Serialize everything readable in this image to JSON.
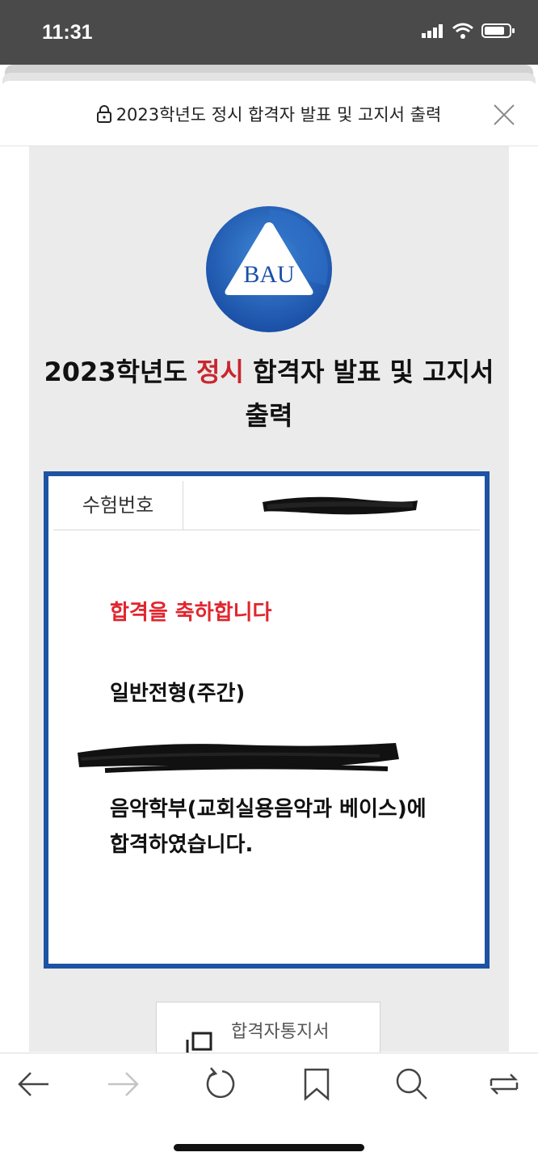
{
  "status_bar": {
    "time": "11:31"
  },
  "sheet": {
    "title": "2023학년도 정시 합격자 발표 및 고지서 출력"
  },
  "page": {
    "logo_text": "BAU",
    "title_prefix": "2023학년도 ",
    "title_accent": "정시",
    "title_suffix": " 합격자 발표 및 고지서 출력"
  },
  "result": {
    "exam_number_label": "수험번호",
    "congrats": "합격을 축하합니다",
    "track": "일반전형(주간)",
    "department": "음악학부(교회실용음악과 베이스)에",
    "passed": "합격하였습니다."
  },
  "cert_button": {
    "label": "합격자통지서"
  },
  "colors": {
    "accent_red": "#e0262e",
    "box_blue": "#1d53a2",
    "title_red": "#c8262e"
  },
  "icons": [
    "lock-icon",
    "close-icon",
    "back-icon",
    "forward-icon",
    "reload-icon",
    "bookmark-icon",
    "search-icon",
    "share-icon",
    "cert-icon"
  ]
}
